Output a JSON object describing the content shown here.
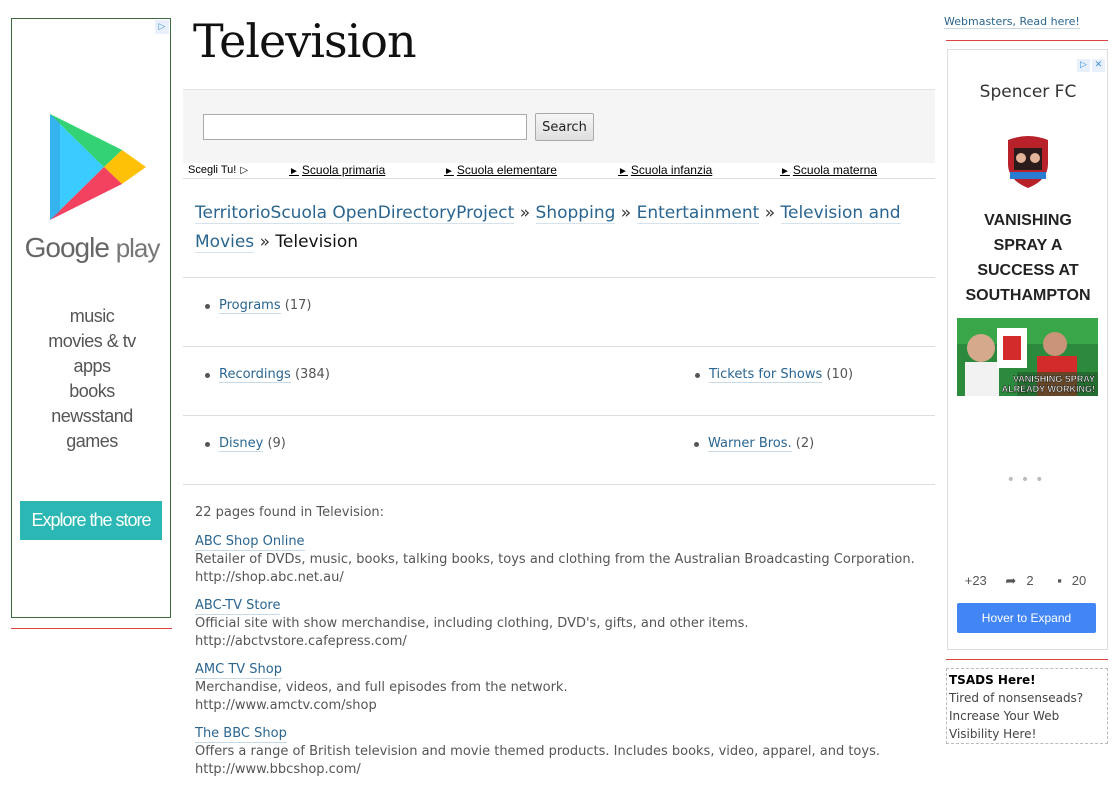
{
  "left_ad": {
    "adchoices_icon": "adchoices-icon",
    "brand_word_1": "Google",
    "brand_word_2": "play",
    "items": [
      "music",
      "movies & tv",
      "apps",
      "books",
      "newsstand",
      "games"
    ],
    "cta": "Explore the store",
    "colors": {
      "cta_bg": "#2bb8b4",
      "border": "#3d6b3d"
    }
  },
  "header": {
    "title": "Television"
  },
  "search": {
    "input_value": "",
    "button_label": "Search"
  },
  "school_bar": {
    "scegli": "Scegli Tu!",
    "links": [
      "Scuola primaria",
      "Scuola elementare",
      "Scuola infanzia",
      "Scuola materna"
    ]
  },
  "breadcrumb": {
    "items": [
      "TerritorioScuola OpenDirectoryProject",
      "Shopping",
      "Entertainment",
      "Television and Movies"
    ],
    "separator": "»",
    "current": "Television"
  },
  "categories": {
    "programs": {
      "label": "Programs",
      "count": "(17)"
    },
    "recordings": {
      "label": "Recordings",
      "count": "(384)"
    },
    "tickets": {
      "label": "Tickets for Shows",
      "count": "(10)"
    },
    "disney": {
      "label": "Disney",
      "count": "(9)"
    },
    "warner": {
      "label": "Warner Bros.",
      "count": "(2)"
    }
  },
  "results": {
    "summary": "22 pages found in Television:",
    "sites": [
      {
        "title": "ABC Shop Online",
        "desc": "Retailer of DVDs, music, books, talking books, toys and clothing from the Australian Broadcasting Corporation.",
        "url": "http://shop.abc.net.au/"
      },
      {
        "title": "ABC-TV Store",
        "desc": "Official site with show merchandise, including clothing, DVD's, gifts, and other items.",
        "url": "http://abctvstore.cafepress.com/"
      },
      {
        "title": "AMC TV Shop",
        "desc": "Merchandise, videos, and full episodes from the network.",
        "url": "http://www.amctv.com/shop"
      },
      {
        "title": "The BBC Shop",
        "desc": "Offers a range of British television and movie themed products. Includes books, video, apparel, and toys.",
        "url": "http://www.bbcshop.com/"
      }
    ]
  },
  "right": {
    "webmasters_link": "Webmasters, Read here!",
    "ad": {
      "brand": "Spencer FC",
      "headline": [
        "VANISHING",
        "SPRAY A",
        "SUCCESS AT",
        "SOUTHAMPTON"
      ],
      "photo_caption_1": "VANISHING SPRAY",
      "photo_caption_2": "ALREADY WORKING!",
      "stats": {
        "plus": "+23",
        "shares": "2",
        "comments": "20"
      },
      "button": "Hover to Expand",
      "colors": {
        "button_bg": "#4285f4"
      }
    },
    "tsads": {
      "title": "TSADS Here!",
      "line1": "Tired of nonsenseads?",
      "line2": "Increase Your Web",
      "line3": "Visibility Here!"
    }
  },
  "colors": {
    "link": "#2a6590",
    "divider_red": "#d44",
    "search_panel": "#f5f5f5"
  }
}
